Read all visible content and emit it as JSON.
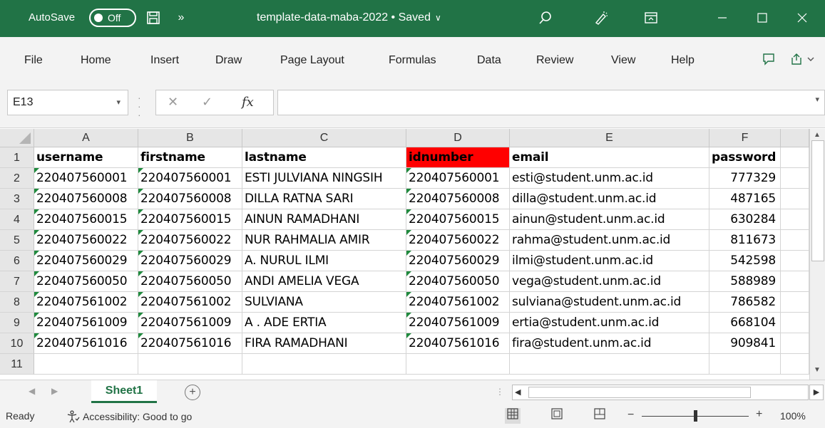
{
  "titlebar": {
    "autosave_label": "AutoSave",
    "autosave_state": "Off",
    "more_glyph": "»",
    "doc_title": "template-data-maba-2022 • Saved",
    "title_chevron": "∨"
  },
  "menu": {
    "items": [
      "File",
      "Home",
      "Insert",
      "Draw",
      "Page Layout",
      "Formulas",
      "Data",
      "Review",
      "View",
      "Help"
    ]
  },
  "formula_bar": {
    "name_box": "E13",
    "fx": "fx",
    "formula": ""
  },
  "columns": [
    "A",
    "B",
    "C",
    "D",
    "E",
    "F"
  ],
  "rows": [
    "1",
    "2",
    "3",
    "4",
    "5",
    "6",
    "7",
    "8",
    "9",
    "10",
    "11"
  ],
  "table": {
    "headers": [
      "username",
      "firstname",
      "lastname",
      "idnumber",
      "email",
      "password"
    ],
    "data": [
      [
        "220407560001",
        "220407560001",
        "ESTI JULVIANA NINGSIH",
        "220407560001",
        "esti@student.unm.ac.id",
        "777329"
      ],
      [
        "220407560008",
        "220407560008",
        "DILLA RATNA SARI",
        "220407560008",
        "dilla@student.unm.ac.id",
        "487165"
      ],
      [
        "220407560015",
        "220407560015",
        "AINUN RAMADHANI",
        "220407560015",
        "ainun@student.unm.ac.id",
        "630284"
      ],
      [
        "220407560022",
        "220407560022",
        "NUR RAHMALIA AMIR",
        "220407560022",
        "rahma@student.unm.ac.id",
        "811673"
      ],
      [
        "220407560029",
        "220407560029",
        "A. NURUL ILMI",
        "220407560029",
        "ilmi@student.unm.ac.id",
        "542598"
      ],
      [
        "220407560050",
        "220407560050",
        "ANDI AMELIA VEGA",
        "220407560050",
        "vega@student.unm.ac.id",
        "588989"
      ],
      [
        "220407561002",
        "220407561002",
        "SULVIANA",
        "220407561002",
        "sulviana@student.unm.ac.id",
        "786582"
      ],
      [
        "220407561009",
        "220407561009",
        "A . ADE ERTIA",
        "220407561009",
        "ertia@student.unm.ac.id",
        "668104"
      ],
      [
        "220407561016",
        "220407561016",
        "FIRA RAMADHANI",
        "220407561016",
        "fira@student.unm.ac.id",
        "909841"
      ]
    ]
  },
  "sheet_tab": "Sheet1",
  "add_sheet": "+",
  "status": {
    "ready": "Ready",
    "accessibility": "Accessibility: Good to go",
    "zoom": "100%",
    "zoom_minus": "−",
    "zoom_plus": "+"
  },
  "colors": {
    "brand": "#217346",
    "header_highlight": "#ff0000"
  }
}
